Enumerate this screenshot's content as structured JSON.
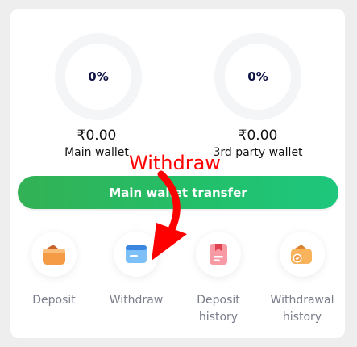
{
  "wallets": [
    {
      "percent": "0%",
      "amount": "₹0.00",
      "label": "Main wallet"
    },
    {
      "percent": "0%",
      "amount": "₹0.00",
      "label": "3rd party wallet"
    }
  ],
  "transfer_button_label": "Main wallet transfer",
  "actions": [
    {
      "label_line1": "Deposit",
      "label_line2": "",
      "icon": "deposit-wallet-icon"
    },
    {
      "label_line1": "Withdraw",
      "label_line2": "",
      "icon": "withdraw-card-icon"
    },
    {
      "label_line1": "Deposit",
      "label_line2": "history",
      "icon": "deposit-history-icon"
    },
    {
      "label_line1": "Withdrawal",
      "label_line2": "history",
      "icon": "withdrawal-history-icon"
    }
  ],
  "annotation": {
    "text": "Withdraw",
    "color": "#ff0000"
  },
  "colors": {
    "accent_green": "#22c06b",
    "text_dark": "#0f1446",
    "text_muted": "#7b7e8b",
    "icon_orange": "#f59a45",
    "icon_blue": "#5aa8f0",
    "icon_pink": "#f07c86"
  }
}
